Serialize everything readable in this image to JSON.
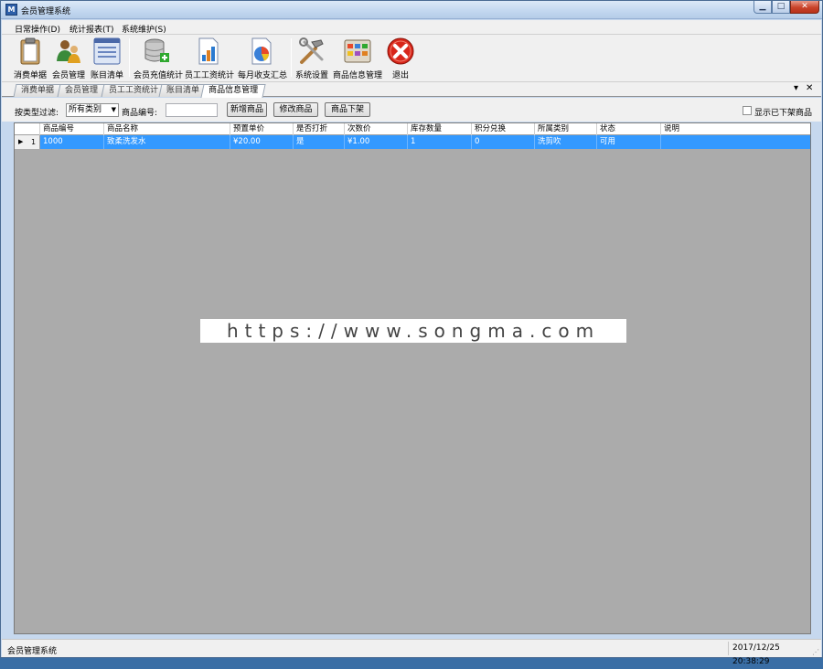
{
  "window": {
    "title": "会员管理系统",
    "icon_label": "M"
  },
  "menu": [
    "日常操作(D)",
    "统计报表(T)",
    "系统维护(S)"
  ],
  "toolbar": [
    {
      "label": "消费单据",
      "icon": "clipboard-icon"
    },
    {
      "label": "会员管理",
      "icon": "members-icon"
    },
    {
      "label": "账目清单",
      "icon": "list-icon"
    },
    {
      "label": "会员充值统计",
      "icon": "database-add-icon"
    },
    {
      "label": "员工工资统计",
      "icon": "bar-chart-icon"
    },
    {
      "label": "每月收支汇总",
      "icon": "pie-chart-icon"
    },
    {
      "label": "系统设置",
      "icon": "tools-icon"
    },
    {
      "label": "商品信息管理",
      "icon": "product-grid-icon"
    },
    {
      "label": "退出",
      "icon": "exit-icon"
    }
  ],
  "tabs": [
    "消费单据",
    "会员管理",
    "员工工资统计",
    "账目清单",
    "商品信息管理"
  ],
  "active_tab": "商品信息管理",
  "tab_controls": {
    "dropdown": "▾",
    "close": "✕"
  },
  "filter": {
    "type_label": "按类型过滤:",
    "type_value": "所有类别",
    "code_label": "商品编号:",
    "code_value": "",
    "add_button": "新增商品",
    "edit_button": "修改商品",
    "remove_button": "商品下架",
    "show_removed_label": "显示已下架商品",
    "show_removed_checked": false
  },
  "grid": {
    "columns": [
      "商品编号",
      "商品名称",
      "预置单价",
      "是否打折",
      "次数价",
      "库存数量",
      "积分兑换",
      "所属类别",
      "状态",
      "说明"
    ],
    "rows": [
      {
        "index": "1",
        "cells": [
          "1000",
          "致柔洗发水",
          "¥20.00",
          "是",
          "¥1.00",
          "1",
          "0",
          "洗剪吹",
          "可用",
          ""
        ]
      }
    ]
  },
  "watermark": "https://www.songma.com",
  "status": {
    "left": "会员管理系统",
    "right": "2017/12/25 20:38:29"
  }
}
